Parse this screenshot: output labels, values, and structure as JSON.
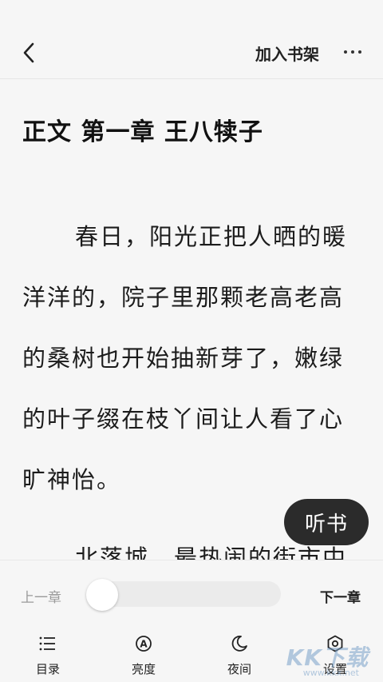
{
  "header": {
    "add_shelf_label": "加入书架"
  },
  "chapter": {
    "title": "正文 第一章 王八犊子",
    "paragraphs": [
      "春日，阳光正把人晒的暖洋洋的，院子里那颗老高老高的桑树也开始抽新芽了，嫩绿的叶子缀在枝丫间让人看了心旷神怡。",
      "北落城，最热闹的街市中"
    ]
  },
  "listen_button": "听书",
  "progress": {
    "prev_label": "上一章",
    "next_label": "下一章",
    "value": 0
  },
  "nav": {
    "items": [
      {
        "label": "目录",
        "icon": "list-icon"
      },
      {
        "label": "亮度",
        "icon": "brightness-icon"
      },
      {
        "label": "夜间",
        "icon": "moon-icon"
      },
      {
        "label": "设置",
        "icon": "settings-icon"
      }
    ]
  },
  "watermark": {
    "brand": "KK下载",
    "url": "www.kkx.net"
  }
}
